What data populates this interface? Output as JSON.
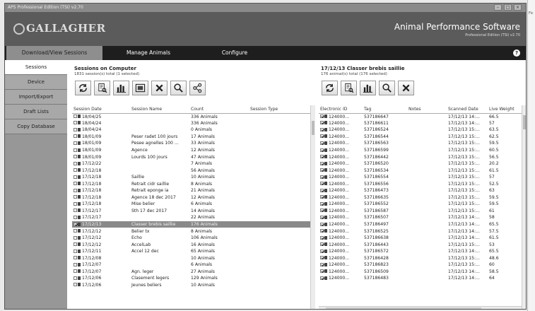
{
  "window": {
    "title": "APS Professional Edition (TSI) v2.70"
  },
  "header": {
    "logo": "GALLAGHER",
    "app_title": "Animal Performance Software",
    "app_subtitle": "Professional Edition (TSI) v2.70"
  },
  "nav": {
    "tabs": [
      "Download/View Sessions",
      "Manage Animals",
      "Configure"
    ],
    "active": 0,
    "help": "?"
  },
  "sidebar": {
    "items": [
      "Sessions",
      "Device",
      "Import/Export",
      "Draft Lists",
      "Copy Database"
    ],
    "active": 0
  },
  "sessions": {
    "title": "Sessions on Computer",
    "subtitle": "1831 session(s) total (1 selected)",
    "toolbar_icons": [
      "refresh-icon",
      "report-icon",
      "chart-icon",
      "export-icon",
      "delete-icon",
      "search-icon",
      "share-icon"
    ],
    "columns": [
      "Session Date",
      "Session Name",
      "Count",
      "Session Type"
    ],
    "rows": [
      {
        "date": "18/04/25",
        "name": "",
        "count": "336 Animals",
        "checked": false,
        "selected": false
      },
      {
        "date": "18/04/24",
        "name": "",
        "count": "336 Animals",
        "checked": false,
        "selected": false
      },
      {
        "date": "18/04/24",
        "name": "",
        "count": "0 Animals",
        "checked": false,
        "selected": false
      },
      {
        "date": "18/01/09",
        "name": "Peser radet 100 jours",
        "count": "17 Animals",
        "checked": false,
        "selected": false
      },
      {
        "date": "18/01/09",
        "name": "Pesee agnelles 100 ...",
        "count": "33 Animals",
        "checked": false,
        "selected": false
      },
      {
        "date": "18/01/09",
        "name": "Agence",
        "count": "12 Animals",
        "checked": false,
        "selected": false
      },
      {
        "date": "18/01/09",
        "name": "Lourds 100 jours",
        "count": "47 Animals",
        "checked": false,
        "selected": false
      },
      {
        "date": "17/12/22",
        "name": "",
        "count": "7 Animals",
        "checked": false,
        "selected": false
      },
      {
        "date": "17/12/18",
        "name": "",
        "count": "56 Animals",
        "checked": false,
        "selected": false
      },
      {
        "date": "17/12/18",
        "name": "Saillie",
        "count": "10 Animals",
        "checked": false,
        "selected": false
      },
      {
        "date": "17/12/18",
        "name": "Retrait cidr saillie",
        "count": "8 Animals",
        "checked": false,
        "selected": false
      },
      {
        "date": "17/12/18",
        "name": "Retrait eponge ia",
        "count": "21 Animals",
        "checked": false,
        "selected": false
      },
      {
        "date": "17/12/18",
        "name": "Agence 18 dec 2017",
        "count": "12 Animals",
        "checked": false,
        "selected": false
      },
      {
        "date": "17/12/18",
        "name": "Mise belier",
        "count": "6 Animals",
        "checked": false,
        "selected": false
      },
      {
        "date": "17/12/17",
        "name": "Sth 17 dec 2017",
        "count": "14 Animals",
        "checked": false,
        "selected": false
      },
      {
        "date": "17/12/17",
        "name": "",
        "count": "22 Animals",
        "checked": false,
        "selected": false
      },
      {
        "date": "17/12/13",
        "name": "Classer brebis saillie",
        "count": "176 Animals",
        "checked": true,
        "selected": true
      },
      {
        "date": "17/12/12",
        "name": "Belier tx",
        "count": "8 Animals",
        "checked": false,
        "selected": false
      },
      {
        "date": "17/12/12",
        "name": "Echo",
        "count": "106 Animals",
        "checked": false,
        "selected": false
      },
      {
        "date": "17/12/12",
        "name": "AccelLab",
        "count": "16 Animals",
        "checked": false,
        "selected": false
      },
      {
        "date": "17/12/11",
        "name": "Accel 12 dec",
        "count": "65 Animals",
        "checked": false,
        "selected": false
      },
      {
        "date": "17/12/08",
        "name": "",
        "count": "10 Animals",
        "checked": false,
        "selected": false
      },
      {
        "date": "17/12/07",
        "name": "",
        "count": "6 Animals",
        "checked": false,
        "selected": false
      },
      {
        "date": "17/12/07",
        "name": "Agn. leger",
        "count": "27 Animals",
        "checked": false,
        "selected": false
      },
      {
        "date": "17/12/06",
        "name": "Clasement legers",
        "count": "129 Animals",
        "checked": false,
        "selected": false
      },
      {
        "date": "17/12/06",
        "name": "Jeunes beliers",
        "count": "10 Animals",
        "checked": false,
        "selected": false
      }
    ]
  },
  "animals": {
    "title": "17/12/13 Classer brebis saillie",
    "subtitle": "176 animal(s) total (176 selected)",
    "toolbar_icons": [
      "refresh-icon",
      "report-icon",
      "chart-icon",
      "search-icon",
      "delete-icon"
    ],
    "columns": [
      "Electronic ID",
      "Tag",
      "Notes",
      "Scanned Date",
      "Live Weight"
    ],
    "rows": [
      {
        "eid": "124000...",
        "tag": "537186647",
        "notes": "",
        "scanned": "17/12/13 14:...",
        "weight": "66.5"
      },
      {
        "eid": "124000...",
        "tag": "537186611",
        "notes": "",
        "scanned": "17/12/13 14:...",
        "weight": "57"
      },
      {
        "eid": "124000...",
        "tag": "537186524",
        "notes": "",
        "scanned": "17/12/13 15:...",
        "weight": "63.5"
      },
      {
        "eid": "124000...",
        "tag": "537186544",
        "notes": "",
        "scanned": "17/12/13 15:...",
        "weight": "62.5"
      },
      {
        "eid": "124000...",
        "tag": "537186563",
        "notes": "",
        "scanned": "17/12/13 15:...",
        "weight": "59.5"
      },
      {
        "eid": "124000...",
        "tag": "537186599",
        "notes": "",
        "scanned": "17/12/13 15:...",
        "weight": "60.5"
      },
      {
        "eid": "124000...",
        "tag": "537186442",
        "notes": "",
        "scanned": "17/12/13 15:...",
        "weight": "56.5"
      },
      {
        "eid": "124000...",
        "tag": "537186520",
        "notes": "",
        "scanned": "17/12/13 15:...",
        "weight": "20.2"
      },
      {
        "eid": "124000...",
        "tag": "537186534",
        "notes": "",
        "scanned": "17/12/13 15:...",
        "weight": "61.5"
      },
      {
        "eid": "124000...",
        "tag": "537186554",
        "notes": "",
        "scanned": "17/12/13 15:...",
        "weight": "57"
      },
      {
        "eid": "124000...",
        "tag": "537186556",
        "notes": "",
        "scanned": "17/12/13 15:...",
        "weight": "52.5"
      },
      {
        "eid": "124000...",
        "tag": "537186473",
        "notes": "",
        "scanned": "17/12/13 15:...",
        "weight": "63"
      },
      {
        "eid": "124000...",
        "tag": "537186635",
        "notes": "",
        "scanned": "17/12/13 15:...",
        "weight": "59.5"
      },
      {
        "eid": "124000...",
        "tag": "537186552",
        "notes": "",
        "scanned": "17/12/13 15:...",
        "weight": "59.5"
      },
      {
        "eid": "124000...",
        "tag": "537186587",
        "notes": "",
        "scanned": "17/12/13 15:...",
        "weight": "61"
      },
      {
        "eid": "124000...",
        "tag": "537186507",
        "notes": "",
        "scanned": "17/12/13 14:...",
        "weight": "58"
      },
      {
        "eid": "124000...",
        "tag": "537186497",
        "notes": "",
        "scanned": "17/12/13 14:...",
        "weight": "65.5"
      },
      {
        "eid": "124000...",
        "tag": "537186525",
        "notes": "",
        "scanned": "17/12/13 14:...",
        "weight": "57.5"
      },
      {
        "eid": "124000...",
        "tag": "537186638",
        "notes": "",
        "scanned": "17/12/13 14:...",
        "weight": "61.5"
      },
      {
        "eid": "124000...",
        "tag": "537186443",
        "notes": "",
        "scanned": "17/12/13 15:...",
        "weight": "53"
      },
      {
        "eid": "124000...",
        "tag": "537186572",
        "notes": "",
        "scanned": "17/12/13 14:...",
        "weight": "65.5"
      },
      {
        "eid": "124000...",
        "tag": "537186428",
        "notes": "",
        "scanned": "17/12/13 15:...",
        "weight": "48.6"
      },
      {
        "eid": "124000...",
        "tag": "537186823",
        "notes": "",
        "scanned": "17/12/13 15:...",
        "weight": "60"
      },
      {
        "eid": "124000...",
        "tag": "537186509",
        "notes": "",
        "scanned": "17/12/13 14:...",
        "weight": "58.5"
      },
      {
        "eid": "124000...",
        "tag": "537186483",
        "notes": "",
        "scanned": "17/12/13 14:...",
        "weight": "64"
      }
    ]
  }
}
